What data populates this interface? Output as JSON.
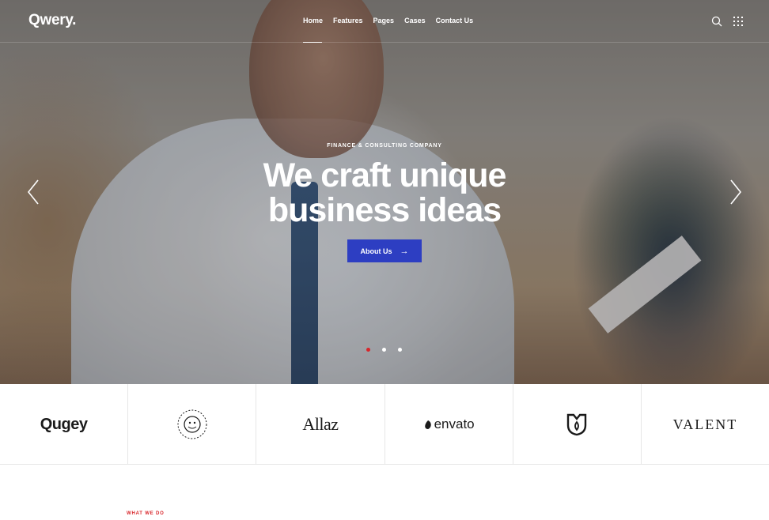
{
  "header": {
    "logo": "Qwery.",
    "nav": [
      "Home",
      "Features",
      "Pages",
      "Cases",
      "Contact Us"
    ],
    "icons": [
      "search-icon",
      "grid-menu-icon"
    ]
  },
  "hero": {
    "eyebrow": "FINANCE & CONSULTING COMPANY",
    "headline_line1": "We craft unique",
    "headline_line2": "business ideas",
    "cta_label": "About Us",
    "slides_total": 3,
    "active_slide": 1,
    "accent": "#2d3ec2",
    "dot_active_color": "#d8262b"
  },
  "partners": [
    "Qugey",
    "Bulldog - Hard to be yours",
    "Allaz",
    "envato",
    "shield-logo",
    "VALENT"
  ],
  "section": {
    "label": "WHAT WE DO"
  }
}
